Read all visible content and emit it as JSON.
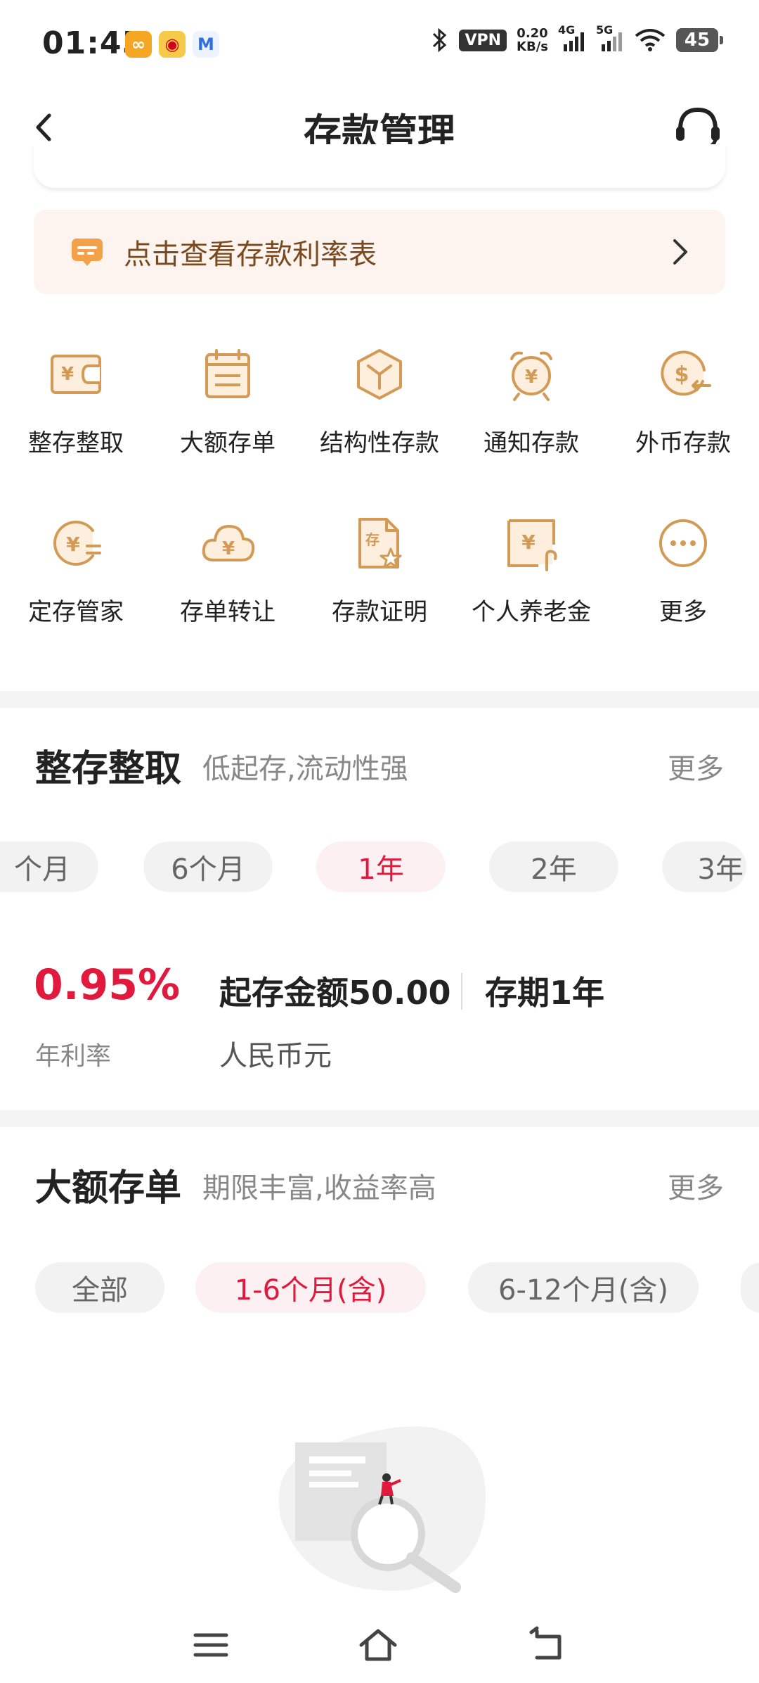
{
  "status_bar": {
    "time": "01:45",
    "vpn": "VPN",
    "net_speed_value": "0.20",
    "net_speed_unit": "KB/s",
    "signal_1": "4G",
    "signal_2": "5G",
    "battery": "45"
  },
  "header": {
    "title": "存款管理"
  },
  "banner": {
    "text": "点击查看存款利率表"
  },
  "grid": [
    {
      "label": "整存整取",
      "icon": "wallet-yen-icon"
    },
    {
      "label": "大额存单",
      "icon": "calendar-doc-icon"
    },
    {
      "label": "结构性存款",
      "icon": "cube-icon"
    },
    {
      "label": "通知存款",
      "icon": "alarm-clock-yen-icon"
    },
    {
      "label": "外币存款",
      "icon": "dollar-exchange-icon"
    },
    {
      "label": "定存管家",
      "icon": "yen-manager-icon"
    },
    {
      "label": "存单转让",
      "icon": "cloud-yen-icon"
    },
    {
      "label": "存款证明",
      "icon": "certificate-icon"
    },
    {
      "label": "个人养老金",
      "icon": "pension-yen-icon"
    },
    {
      "label": "更多",
      "icon": "more-dots-icon"
    }
  ],
  "section_fixed": {
    "title": "整存整取",
    "subtitle": "低起存,流动性强",
    "more": "更多",
    "terms": [
      "个月",
      "6个月",
      "1年",
      "2年",
      "3年"
    ],
    "active_term": "1年",
    "rate": "0.95%",
    "rate_label": "年利率",
    "min_amount": "起存金额50.00",
    "currency": "人民币元",
    "period": "存期1年"
  },
  "section_cd": {
    "title": "大额存单",
    "subtitle": "期限丰富,收益率高",
    "more": "更多",
    "filters": [
      "全部",
      "1-6个月(含)",
      "6-12个月(含)"
    ],
    "active_filter": "1-6个月(含)"
  },
  "colors": {
    "accent_red": "#e0193d",
    "icon_gold": "#d39a55",
    "banner_bg": "#fdf4ef"
  }
}
